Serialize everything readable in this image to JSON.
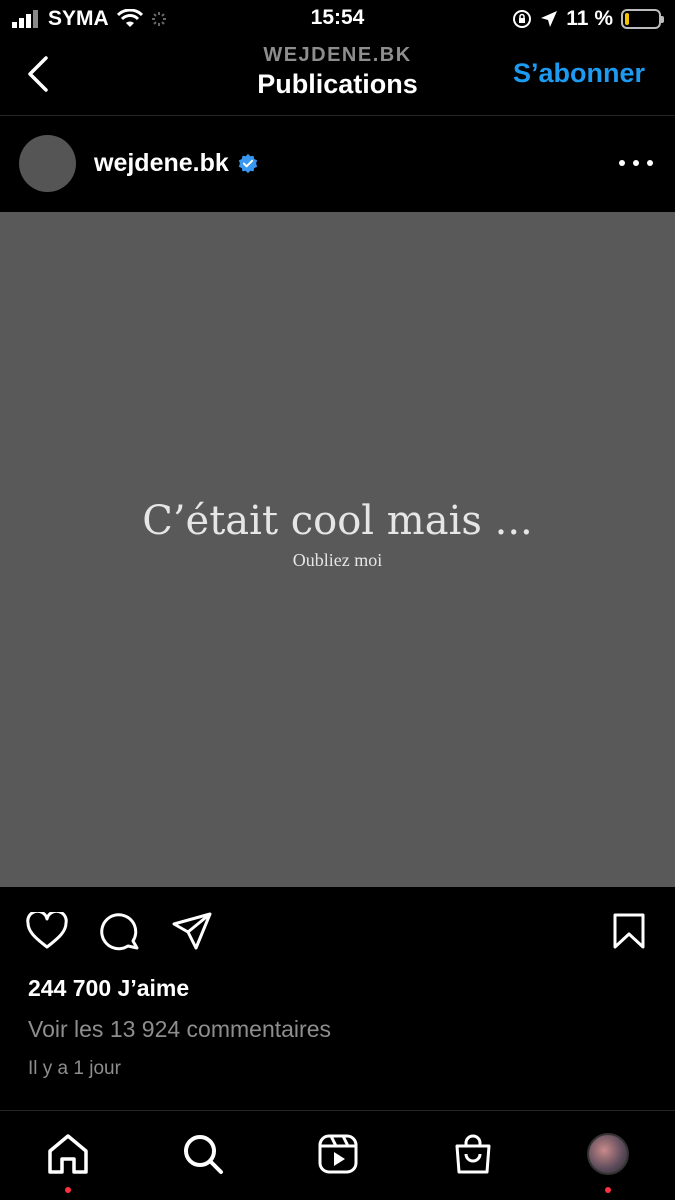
{
  "status": {
    "carrier": "SYMA",
    "time": "15:54",
    "battery": "11 %",
    "battery_level": 0.11
  },
  "header": {
    "subtitle": "WEJDENE.BK",
    "title": "Publications",
    "follow_label": "S’abonner",
    "accent_color": "#1d9bf0"
  },
  "post": {
    "username": "wejdene.bk",
    "verified": true,
    "image_text_main": "C’était cool mais ...",
    "image_text_sub": "Oubliez moi",
    "image_bg": "#595959",
    "likes": "244 700 J’aime",
    "comments": "Voir les 13 924 commentaires",
    "time_ago": "Il y a 1 jour"
  },
  "icons": {
    "actions": [
      "heart-icon",
      "comment-icon",
      "share-icon",
      "bookmark-icon"
    ],
    "tabs": [
      "home-icon",
      "search-icon",
      "reels-icon",
      "shop-icon",
      "profile-avatar"
    ]
  }
}
